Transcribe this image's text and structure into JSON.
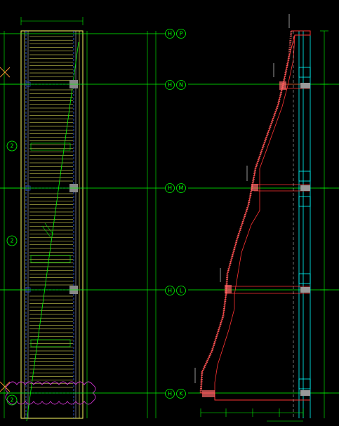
{
  "grid_axes": [
    {
      "row": "H",
      "col": "P"
    },
    {
      "row": "H",
      "col": "N"
    },
    {
      "row": "H",
      "col": "M"
    },
    {
      "row": "H",
      "col": "L"
    },
    {
      "row": "H",
      "col": "K"
    }
  ],
  "left_axis_bubbles": [
    "2",
    "2",
    "2"
  ],
  "colors": {
    "background": "#000000",
    "grid_line": "#00ff00",
    "structure": "#ffff66",
    "dashed_beam": "#3366ff",
    "section_outline": "#ff3333",
    "hatch": "#ff6666",
    "cyan_members": "#00ffff",
    "revision_cloud": "#cc33cc",
    "dimension_text": "#ffffff"
  }
}
